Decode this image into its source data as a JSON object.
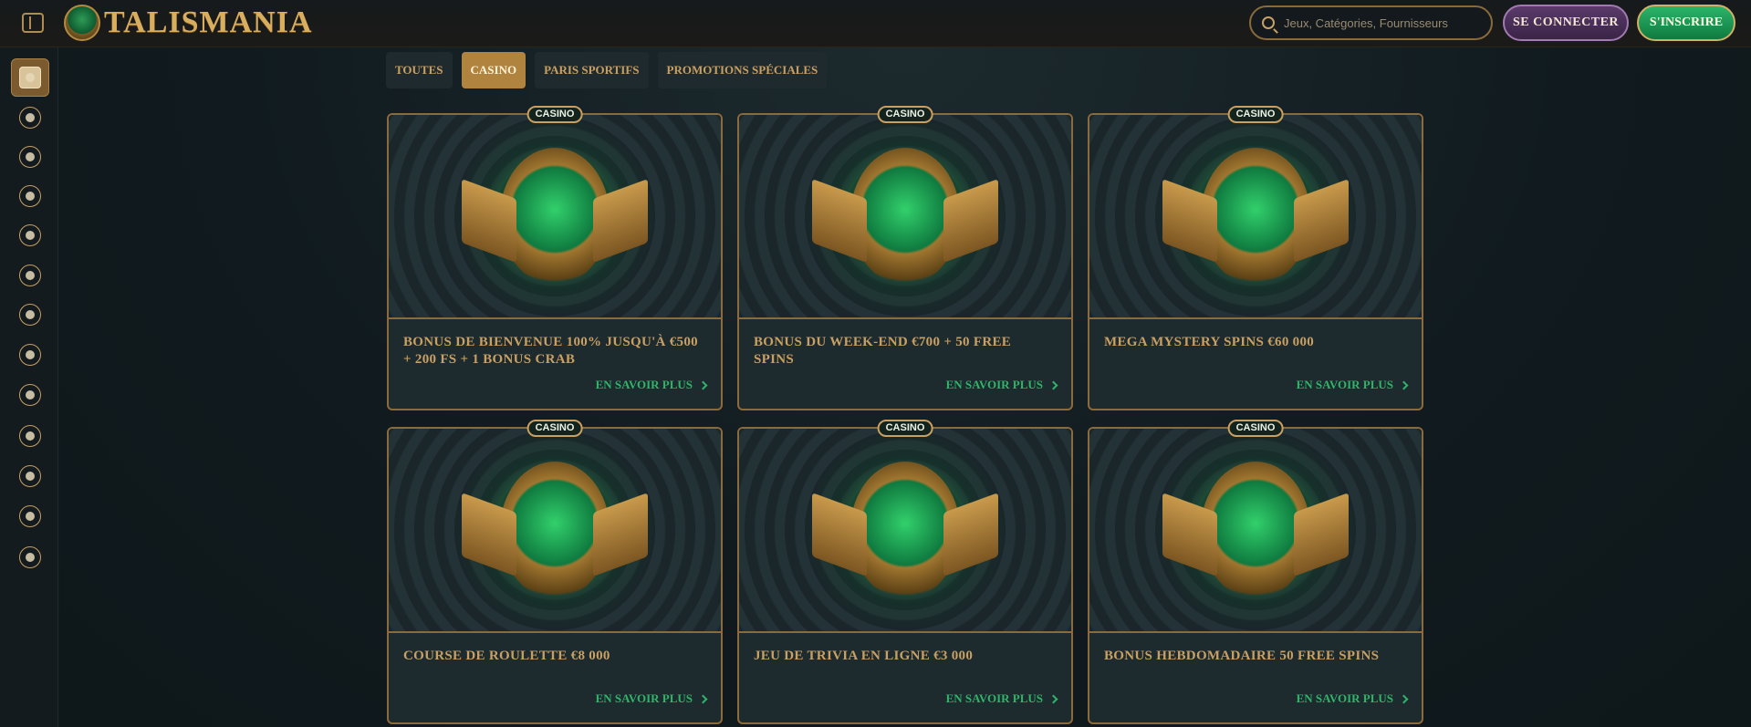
{
  "header": {
    "brand": "TALISMANIA",
    "search_placeholder": "Jeux, Catégories, Fournisseurs",
    "login_label": "SE CONNECTER",
    "signup_label": "S'INSCRIRE"
  },
  "sidebar": {
    "items": [
      {
        "icon": "promotions-icon",
        "active": true
      },
      {
        "icon": "sport-icon",
        "active": false
      },
      {
        "icon": "casino-icon",
        "active": false
      },
      {
        "icon": "cards-icon",
        "active": false
      },
      {
        "icon": "clover-icon",
        "active": false
      },
      {
        "icon": "soccer-icon",
        "active": false
      },
      {
        "icon": "play-icon",
        "active": false
      },
      {
        "icon": "gamepad-icon",
        "active": false
      },
      {
        "icon": "ribbon-icon",
        "active": false
      },
      {
        "icon": "trophy-icon",
        "active": false
      },
      {
        "icon": "chat-icon",
        "active": false
      },
      {
        "icon": "bank-icon",
        "active": false
      },
      {
        "icon": "diamond-icon",
        "active": false
      }
    ]
  },
  "tabs": [
    {
      "label": "TOUTES",
      "active": false
    },
    {
      "label": "CASINO",
      "active": true
    },
    {
      "label": "PARIS SPORTIFS",
      "active": false
    },
    {
      "label": "PROMOTIONS SPÉCIALES",
      "active": false
    }
  ],
  "promotions": [
    {
      "badge": "CASINO",
      "title": "BONUS DE BIENVENUE 100% JUSQU'À €500 + 200 FS + 1 BONUS CRAB",
      "link": "EN SAVOIR PLUS",
      "image": "scarab-emblem"
    },
    {
      "badge": "CASINO",
      "title": "BONUS DU WEEK-END €700 + 50 FREE SPINS",
      "link": "EN SAVOIR PLUS",
      "image": "serpent-emblem"
    },
    {
      "badge": "CASINO",
      "title": "MEGA MYSTERY SPINS €60 000",
      "link": "EN SAVOIR PLUS",
      "image": "anubis-emblem"
    },
    {
      "badge": "CASINO",
      "title": "COURSE DE ROULETTE €8 000",
      "link": "EN SAVOIR PLUS",
      "image": "serpent-emblem"
    },
    {
      "badge": "CASINO",
      "title": "JEU DE TRIVIA EN LIGNE €3 000",
      "link": "EN SAVOIR PLUS",
      "image": "serpent-emblem"
    },
    {
      "badge": "CASINO",
      "title": "BONUS HEBDOMADAIRE 50 FREE SPINS",
      "link": "EN SAVOIR PLUS",
      "image": "horus-emblem"
    }
  ]
}
